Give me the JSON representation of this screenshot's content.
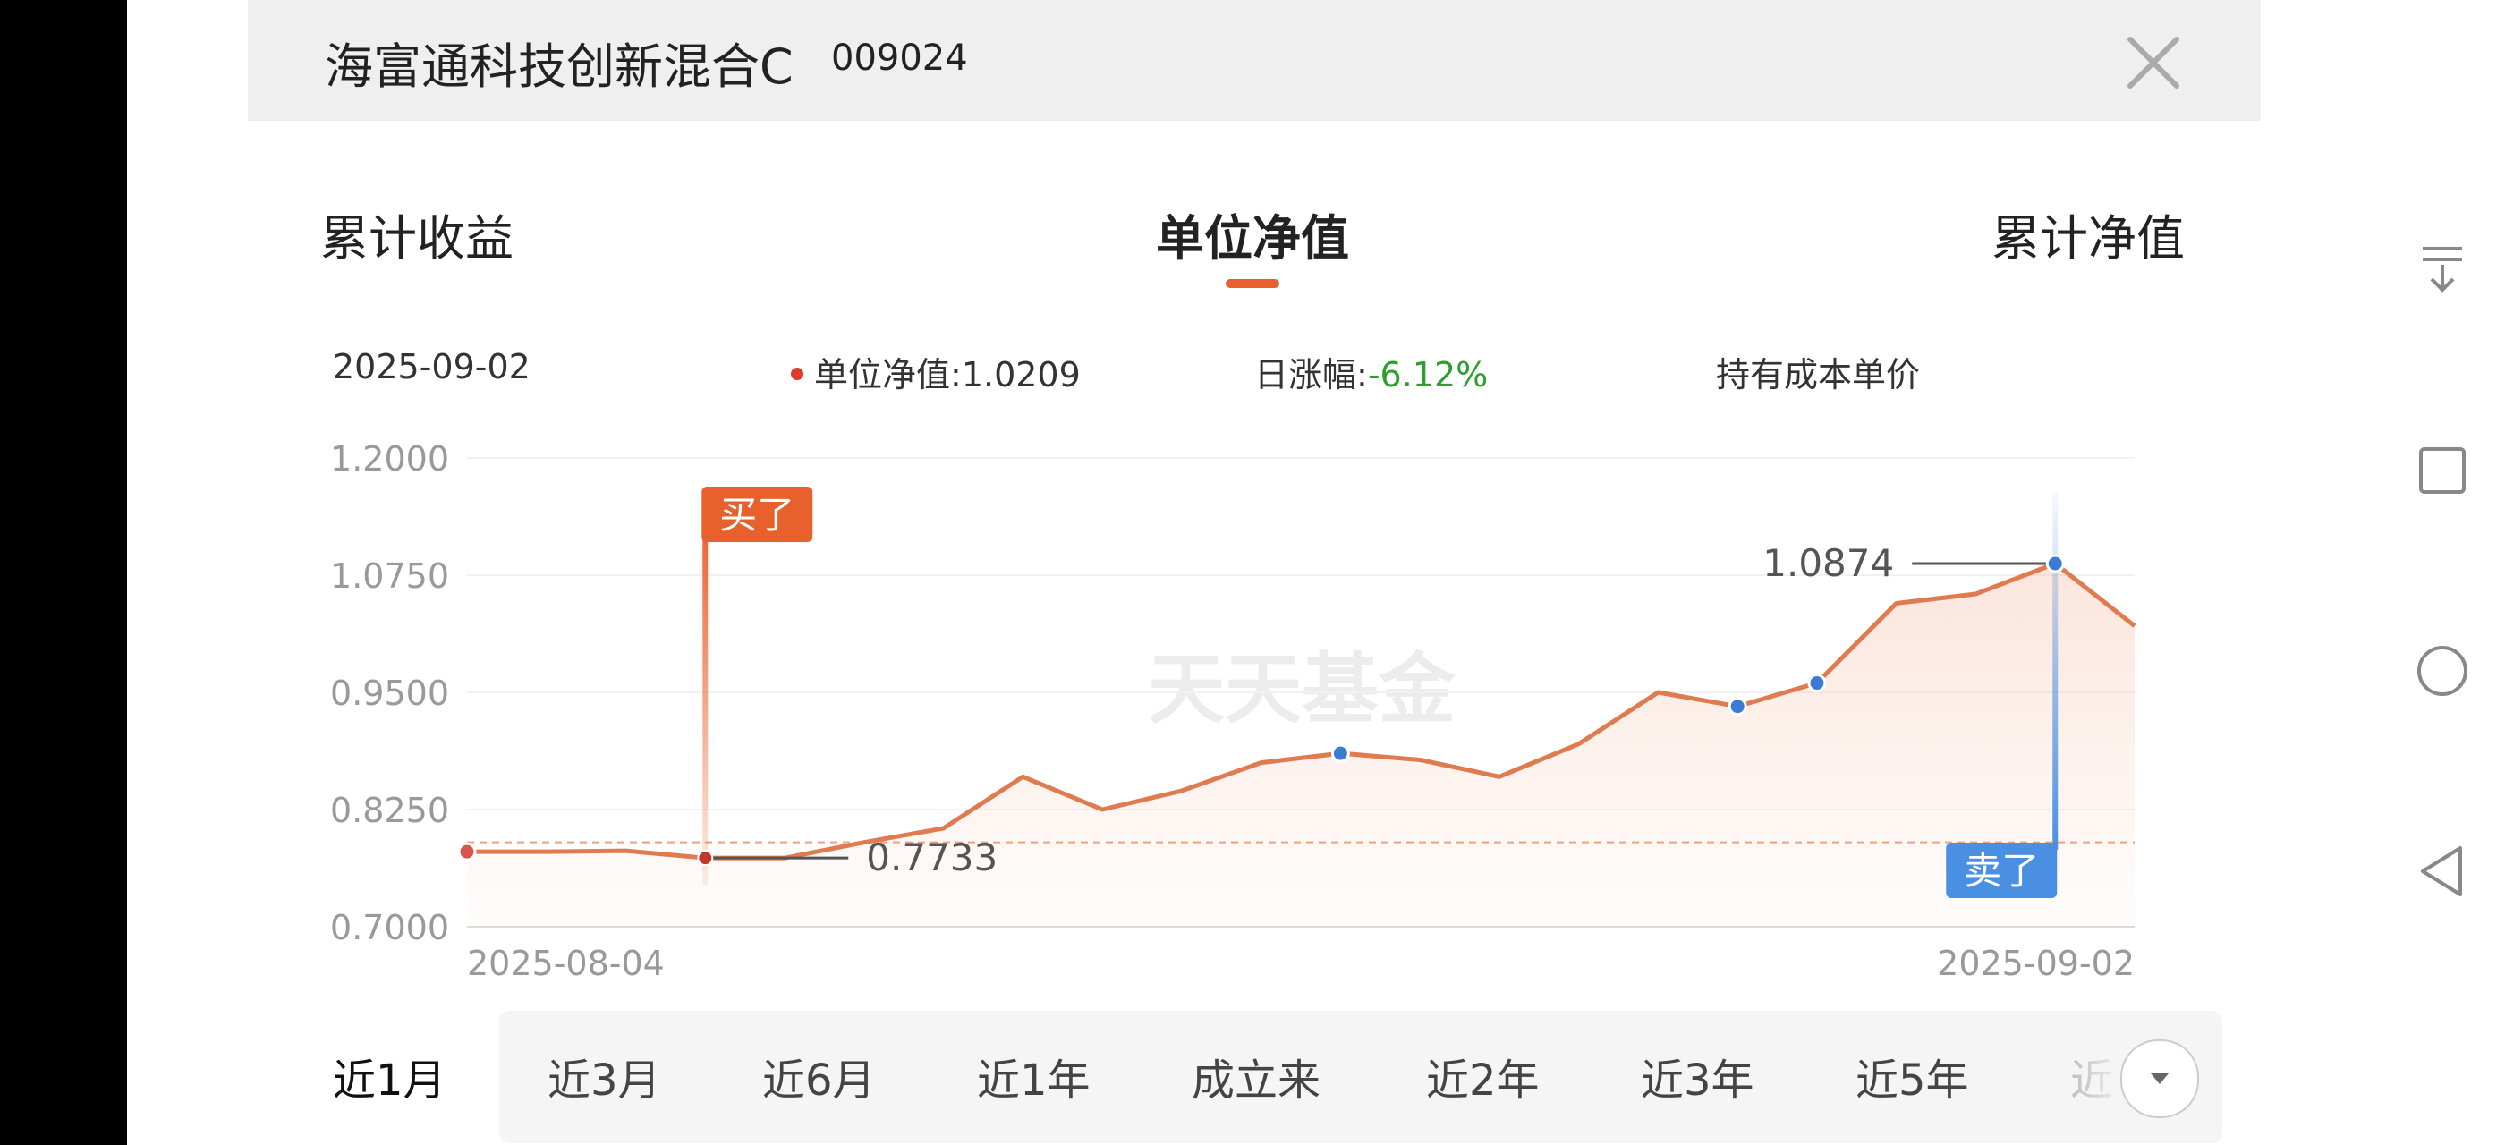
{
  "header": {
    "fund_name": "海富通科技创新混合C",
    "fund_code": "009024",
    "close_icon": "close-icon"
  },
  "tabs": [
    {
      "label": "累计收益",
      "active": false
    },
    {
      "label": "单位净值",
      "active": true
    },
    {
      "label": "累计净值",
      "active": false
    }
  ],
  "info": {
    "date": "2025-09-02",
    "nav_label": "单位净值:",
    "nav_value": "1.0209",
    "change_label": "日涨幅:",
    "change_value": "-6.12%",
    "cost_label": "持有成本单价"
  },
  "watermark": "天天基金",
  "colors": {
    "accent": "#e8612c",
    "line": "#e07a4f",
    "buy": "#e8612c",
    "sell": "#4a90e2",
    "down": "#2ca02c"
  },
  "chart_data": {
    "type": "line",
    "series": [
      {
        "values": [
          0.78,
          0.78,
          0.781,
          0.7733,
          0.7733,
          0.79,
          0.805,
          0.86,
          0.825,
          0.845,
          0.875,
          0.885,
          0.878,
          0.86,
          0.895,
          0.95,
          0.935,
          0.96,
          1.045,
          1.055,
          1.0874,
          1.0209
        ]
      }
    ],
    "x_start_label": "2025-08-04",
    "x_end_label": "2025-09-02",
    "yticks": [
      "1.2000",
      "1.0750",
      "0.9500",
      "0.8250",
      "0.7000"
    ],
    "ylim": [
      0.7,
      1.2
    ],
    "cost_line": 0.79,
    "marked_points": [
      0,
      11,
      16,
      17,
      20
    ],
    "buy": {
      "index": 3,
      "label": "买了",
      "value_label": "0.7733"
    },
    "sell": {
      "index": 20,
      "label": "卖了",
      "value_label": "1.0874"
    },
    "grid": true
  },
  "ranges": [
    {
      "label": "近1月",
      "active": true
    },
    {
      "label": "近3月",
      "active": false
    },
    {
      "label": "近6月",
      "active": false
    },
    {
      "label": "近1年",
      "active": false
    },
    {
      "label": "成立来",
      "active": false
    },
    {
      "label": "近2年",
      "active": false
    },
    {
      "label": "近3年",
      "active": false
    },
    {
      "label": "近5年",
      "active": false
    },
    {
      "label": "近",
      "active": false
    }
  ],
  "nav_icons": [
    "download-icon",
    "square-icon",
    "circle-icon",
    "back-triangle-icon"
  ]
}
